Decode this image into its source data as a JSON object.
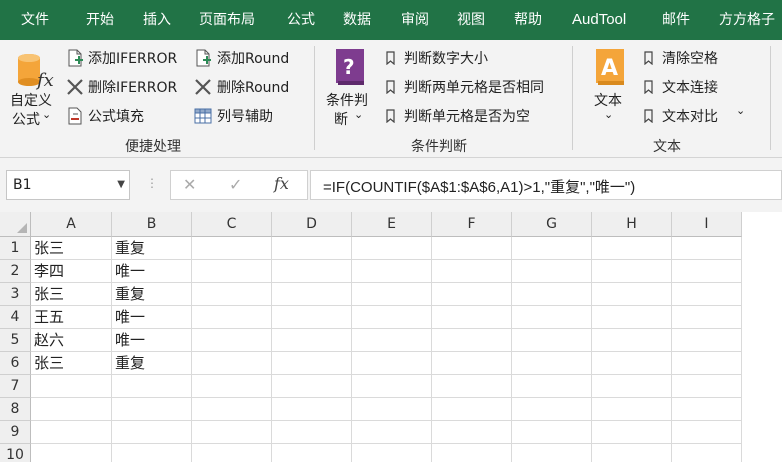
{
  "menu": {
    "tabs": [
      "文件",
      "开始",
      "插入",
      "页面布局",
      "公式",
      "数据",
      "审阅",
      "视图",
      "帮助",
      "AudTool",
      "邮件",
      "方方格子"
    ]
  },
  "ribbon": {
    "groups": {
      "convenience": {
        "label": "便捷处理",
        "custom_function": {
          "line1": "自定义",
          "line2": "公式",
          "arrow": "⌄"
        },
        "add_iferror": "添加IFERROR",
        "delete_iferror": "删除IFERROR",
        "formula_fill": "公式填充",
        "add_round": "添加Round",
        "delete_round": "删除Round",
        "column_helper": "列号辅助"
      },
      "condition": {
        "label": "条件判断",
        "condition_judge": {
          "line1": "条件判",
          "line2": "断",
          "arrow": "⌄"
        },
        "number_compare": "判断数字大小",
        "two_cells_same": "判断两单元格是否相同",
        "cell_empty": "判断单元格是否为空"
      },
      "text": {
        "label": "文本",
        "text_button": {
          "label": "文本",
          "arrow": "⌄"
        },
        "clear_spaces": "清除空格",
        "text_join": "文本连接",
        "text_compare": "文本对比",
        "more_arrow": "⌄"
      }
    }
  },
  "formula_bar": {
    "name_box": "B1",
    "name_box_arrow": "▼",
    "cancel_symbol": "✕",
    "enter_symbol": "✓",
    "fx_symbol": "fx",
    "formula": "=IF(COUNTIF($A$1:$A$6,A1)>1,\"重复\",\"唯一\")"
  },
  "sheet": {
    "columns": [
      "A",
      "B",
      "C",
      "D",
      "E",
      "F",
      "G",
      "H",
      "I"
    ],
    "rows": [
      {
        "num": "1",
        "cells": [
          "张三",
          "重复"
        ]
      },
      {
        "num": "2",
        "cells": [
          "李四",
          "唯一"
        ]
      },
      {
        "num": "3",
        "cells": [
          "张三",
          "重复"
        ]
      },
      {
        "num": "4",
        "cells": [
          "王五",
          "唯一"
        ]
      },
      {
        "num": "5",
        "cells": [
          "赵六",
          "唯一"
        ]
      },
      {
        "num": "6",
        "cells": [
          "张三",
          "重复"
        ]
      },
      {
        "num": "7",
        "cells": [
          "",
          ""
        ]
      },
      {
        "num": "8",
        "cells": [
          "",
          ""
        ]
      },
      {
        "num": "9",
        "cells": [
          "",
          ""
        ]
      },
      {
        "num": "10",
        "cells": [
          "",
          ""
        ]
      }
    ]
  },
  "colors": {
    "menu_bg": "#217346",
    "ribbon_bg": "#f3f3f3",
    "icon_purple": "#7e3c8f",
    "icon_orange": "#f4a53a",
    "icon_red": "#c0392b"
  }
}
